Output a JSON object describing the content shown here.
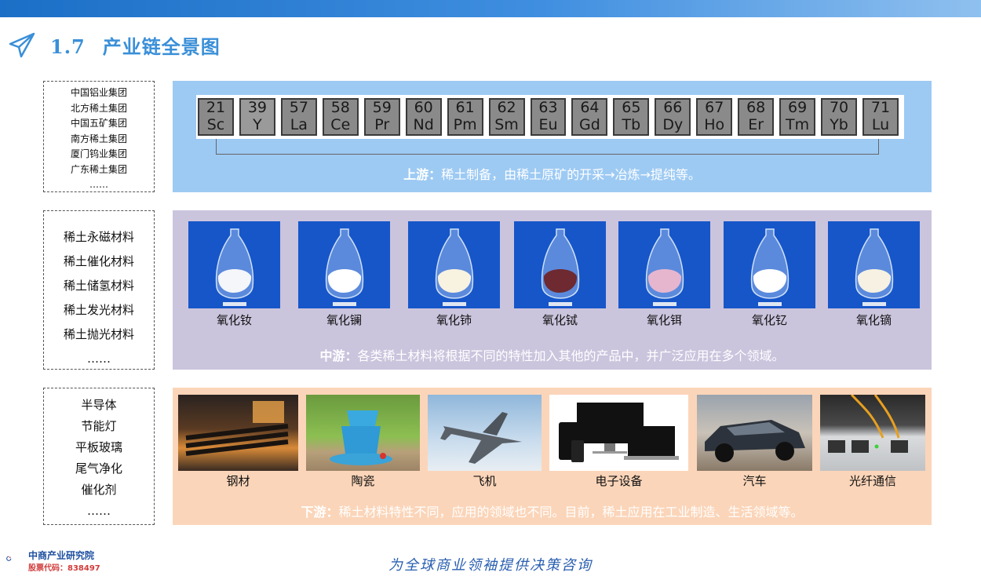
{
  "section": {
    "number": "1.7",
    "title": "产业链全景图"
  },
  "upstream": {
    "companies": [
      "中国铝业集团",
      "北方稀土集团",
      "中国五矿集团",
      "南方稀土集团",
      "厦门钨业集团",
      "广东稀土集团",
      "……"
    ],
    "elements": [
      {
        "n": "21",
        "s": "Sc"
      },
      {
        "n": "39",
        "s": "Y"
      },
      {
        "n": "57",
        "s": "La"
      },
      {
        "n": "58",
        "s": "Ce"
      },
      {
        "n": "59",
        "s": "Pr"
      },
      {
        "n": "60",
        "s": "Nd"
      },
      {
        "n": "61",
        "s": "Pm"
      },
      {
        "n": "62",
        "s": "Sm"
      },
      {
        "n": "63",
        "s": "Eu"
      },
      {
        "n": "64",
        "s": "Gd"
      },
      {
        "n": "65",
        "s": "Tb"
      },
      {
        "n": "66",
        "s": "Dy"
      },
      {
        "n": "67",
        "s": "Ho"
      },
      {
        "n": "68",
        "s": "Er"
      },
      {
        "n": "69",
        "s": "Tm"
      },
      {
        "n": "70",
        "s": "Yb"
      },
      {
        "n": "71",
        "s": "Lu"
      }
    ],
    "desc_label": "上游：",
    "desc_text": "稀土制备，由稀土原矿的开采→冶炼→提纯等。"
  },
  "midstream": {
    "materials": [
      "稀土永磁材料",
      "稀土催化材料",
      "稀土储氢材料",
      "稀土发光材料",
      "稀土抛光材料",
      "……"
    ],
    "oxides": [
      {
        "label": "氧化钕",
        "powder": "#f4f6fa"
      },
      {
        "label": "氧化镧",
        "powder": "#ffffff"
      },
      {
        "label": "氧化铈",
        "powder": "#f8f2e0"
      },
      {
        "label": "氧化铽",
        "powder": "#6e2a30"
      },
      {
        "label": "氧化铒",
        "powder": "#e6b6cf"
      },
      {
        "label": "氧化钇",
        "powder": "#ffffff"
      },
      {
        "label": "氧化镝",
        "powder": "#f6f1e2"
      }
    ],
    "desc_label": "中游：",
    "desc_text": "各类稀土材料将根据不同的特性加入其他的产品中，并广泛应用在多个领域。"
  },
  "downstream": {
    "applications": [
      "半导体",
      "节能灯",
      "平板玻璃",
      "尾气净化",
      "催化剂",
      "……"
    ],
    "products": [
      {
        "label": "钢材",
        "icon": "steel-mill-image"
      },
      {
        "label": "陶瓷",
        "icon": "ceramic-cups-image"
      },
      {
        "label": "飞机",
        "icon": "fighter-jet-image"
      },
      {
        "label": "电子设备",
        "icon": "electronic-devices-image"
      },
      {
        "label": "汽车",
        "icon": "car-image"
      },
      {
        "label": "光纤通信",
        "icon": "fiber-switch-image"
      }
    ],
    "desc_label": "下游：",
    "desc_text": "稀土材料特性不同，应用的领域也不同。目前，稀土应用在工业制造、生活领域等。"
  },
  "footer": {
    "logo_name": "中商产业研究院",
    "stock_code": "股票代码：838497",
    "slogan": "为全球商业领袖提供决策咨询"
  },
  "colors": {
    "accent": "#3a8fd8",
    "upstream_bg": "#9dcaf3",
    "midstream_bg": "#cbc4dd",
    "downstream_bg": "#fbd5b9"
  }
}
